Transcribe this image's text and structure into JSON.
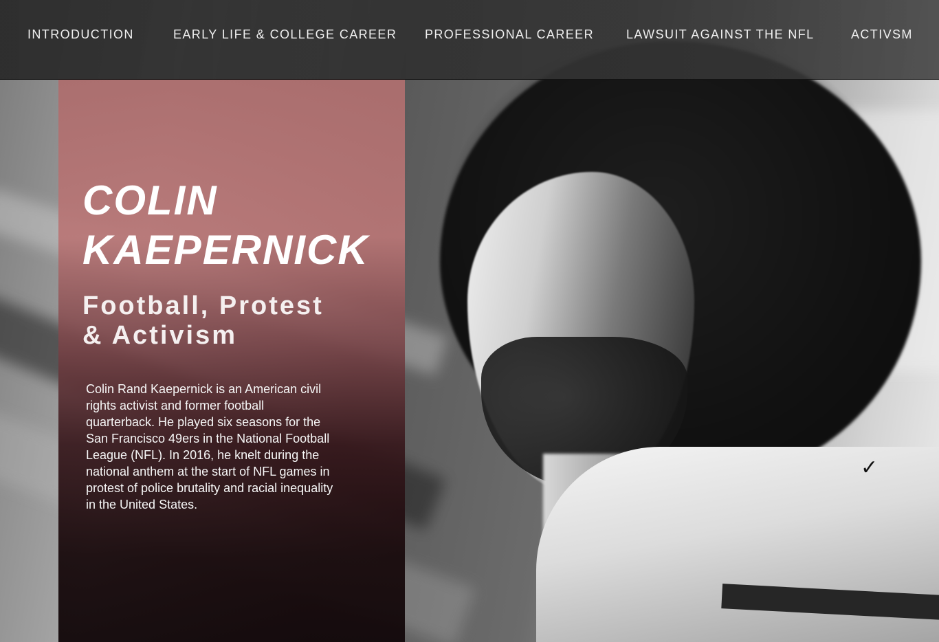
{
  "nav": {
    "items": [
      {
        "label": "INTRODUCTION"
      },
      {
        "label": "EARLY LIFE & COLLEGE CAREER"
      },
      {
        "label": "PROFESSIONAL CAREER"
      },
      {
        "label": "LAWSUIT AGAINST THE NFL"
      },
      {
        "label": "ACTIVSM"
      }
    ]
  },
  "hero": {
    "title_line1": "COLIN",
    "title_line2": "KAEPERNICK",
    "subtitle_line1": "Football, Protest",
    "subtitle_line2": "& Activism",
    "description": "Colin Rand Kaepernick is an American civil rights activist and former football quarterback. He played six seasons for the San Francisco 49ers in the National Football League (NFL). In 2016, he knelt during the national anthem at the start of NFL games in protest of police brutality and racial inequality in the United States."
  },
  "colors": {
    "panel_top": "#b47676",
    "panel_bottom": "#140809",
    "nav_bg": "#2f2f2f",
    "text": "#ffffff"
  },
  "icons": {
    "jersey_logo": "swoosh-icon"
  }
}
